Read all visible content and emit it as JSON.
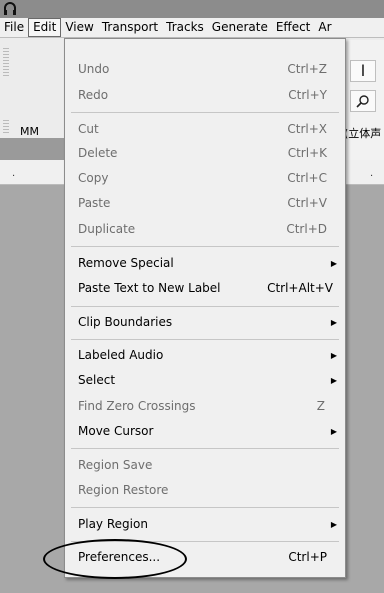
{
  "menubar": {
    "items": [
      "File",
      "Edit",
      "View",
      "Transport",
      "Tracks",
      "Generate",
      "Effect",
      "Ar"
    ],
    "active_index": 1
  },
  "toolbar": {
    "mm_label": "MM",
    "stereo_label": "(立体声",
    "dots": [
      ".",
      "."
    ]
  },
  "edit_menu": {
    "items": [
      {
        "label": "Undo",
        "shortcut": "Ctrl+Z",
        "enabled": false,
        "submenu": false
      },
      {
        "label": "Redo",
        "shortcut": "Ctrl+Y",
        "enabled": false,
        "submenu": false
      },
      {
        "label": "Cut",
        "shortcut": "Ctrl+X",
        "enabled": false,
        "submenu": false
      },
      {
        "label": "Delete",
        "shortcut": "Ctrl+K",
        "enabled": false,
        "submenu": false
      },
      {
        "label": "Copy",
        "shortcut": "Ctrl+C",
        "enabled": false,
        "submenu": false
      },
      {
        "label": "Paste",
        "shortcut": "Ctrl+V",
        "enabled": false,
        "submenu": false
      },
      {
        "label": "Duplicate",
        "shortcut": "Ctrl+D",
        "enabled": false,
        "submenu": false
      },
      {
        "label": "Remove Special",
        "shortcut": "",
        "enabled": true,
        "submenu": true
      },
      {
        "label": "Paste Text to New Label",
        "shortcut": "Ctrl+Alt+V",
        "enabled": true,
        "submenu": false
      },
      {
        "label": "Clip Boundaries",
        "shortcut": "",
        "enabled": true,
        "submenu": true
      },
      {
        "label": "Labeled Audio",
        "shortcut": "",
        "enabled": true,
        "submenu": true
      },
      {
        "label": "Select",
        "shortcut": "",
        "enabled": true,
        "submenu": true
      },
      {
        "label": "Find Zero Crossings",
        "shortcut": "Z",
        "enabled": false,
        "submenu": false
      },
      {
        "label": "Move Cursor",
        "shortcut": "",
        "enabled": true,
        "submenu": true
      },
      {
        "label": "Region Save",
        "shortcut": "",
        "enabled": false,
        "submenu": false
      },
      {
        "label": "Region Restore",
        "shortcut": "",
        "enabled": false,
        "submenu": false
      },
      {
        "label": "Play Region",
        "shortcut": "",
        "enabled": true,
        "submenu": true
      },
      {
        "label": "Preferences...",
        "shortcut": "Ctrl+P",
        "enabled": true,
        "submenu": false
      }
    ]
  }
}
